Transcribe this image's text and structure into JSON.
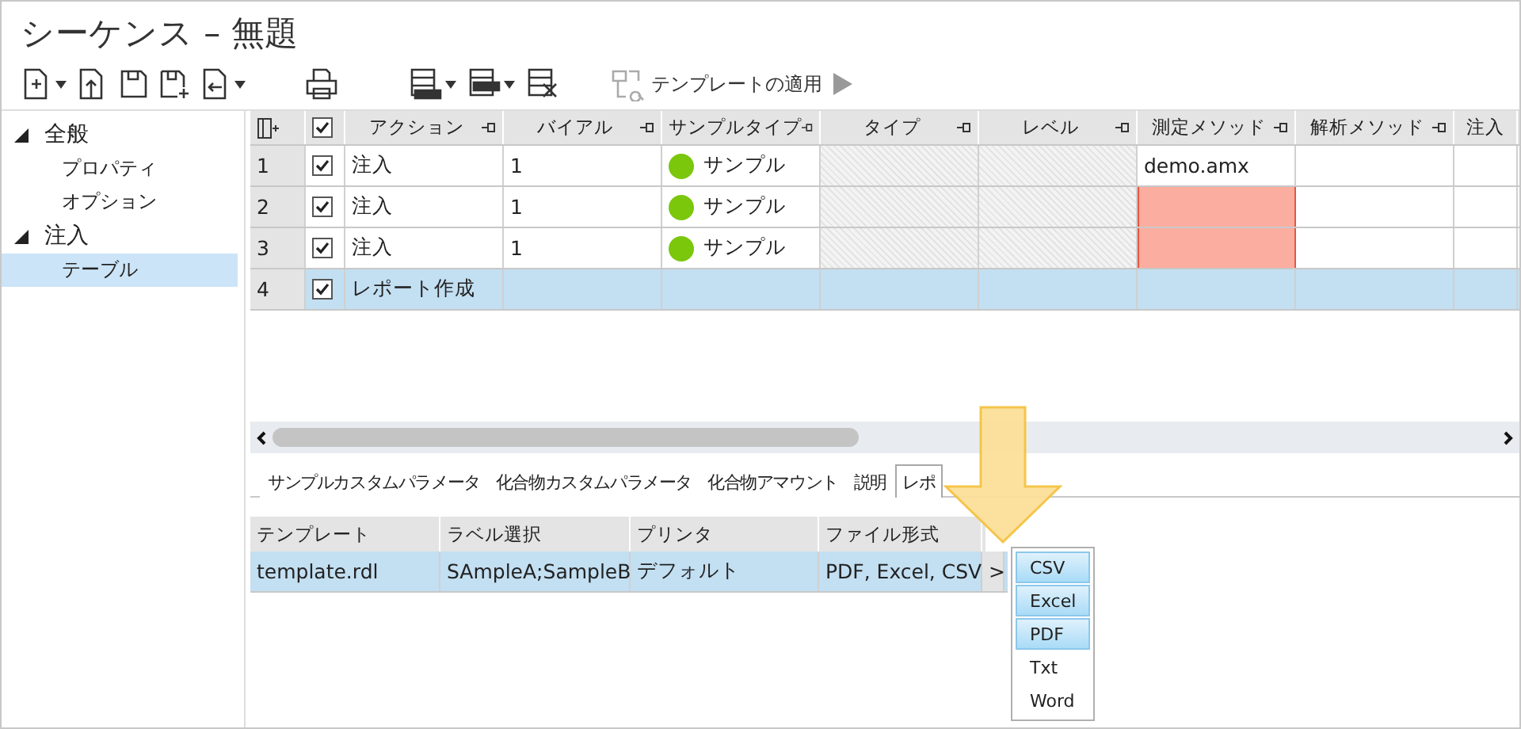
{
  "window": {
    "title": "シーケンス – 無題"
  },
  "toolbar": {
    "apply_template": "テンプレートの適用"
  },
  "sidebar": {
    "items": [
      {
        "label": "全般",
        "expanded": true,
        "children": [
          {
            "label": "プロパティ",
            "selected": false
          },
          {
            "label": "オプション",
            "selected": false
          }
        ]
      },
      {
        "label": "注入",
        "expanded": true,
        "children": [
          {
            "label": "テーブル",
            "selected": true
          }
        ]
      }
    ]
  },
  "table": {
    "select_all_checked": true,
    "columns": [
      {
        "label": "アクション",
        "hatched": false
      },
      {
        "label": "バイアル",
        "hatched": false
      },
      {
        "label": "サンプルタイプ",
        "hatched": false
      },
      {
        "label": "タイプ",
        "hatched": true
      },
      {
        "label": "レベル",
        "hatched": true
      },
      {
        "label": "測定メソッド",
        "hatched": false
      },
      {
        "label": "解析メソッド",
        "hatched": false
      },
      {
        "label": "注入",
        "hatched": false
      }
    ],
    "rows": [
      {
        "number": "1",
        "checked": true,
        "selected": false,
        "action": "注入",
        "vial": "1",
        "sample_type": {
          "label": "サンプル",
          "color": "#7ac70c"
        },
        "method": "demo.amx",
        "method_error": false
      },
      {
        "number": "2",
        "checked": true,
        "selected": false,
        "action": "注入",
        "vial": "1",
        "sample_type": {
          "label": "サンプル",
          "color": "#7ac70c"
        },
        "method_error": true
      },
      {
        "number": "3",
        "checked": true,
        "selected": false,
        "action": "注入",
        "vial": "1",
        "sample_type": {
          "label": "サンプル",
          "color": "#7ac70c"
        },
        "method_error": true
      },
      {
        "number": "4",
        "checked": true,
        "selected": true,
        "action": "レポート作成",
        "method_error": false
      }
    ]
  },
  "detail_tabs": [
    {
      "label": "サンプルカスタムパラメータ",
      "selected": false
    },
    {
      "label": "化合物カスタムパラメータ",
      "selected": false
    },
    {
      "label": "化合物アマウント",
      "selected": false
    },
    {
      "label": "説明",
      "selected": false
    },
    {
      "label": "レポ",
      "selected": true
    }
  ],
  "report_table": {
    "columns": [
      "テンプレート",
      "ラベル選択",
      "プリンタ",
      "ファイル形式"
    ],
    "rows": [
      {
        "selected": true,
        "cells": [
          "template.rdl",
          "SAmpleA;SampleB",
          "デフォルト",
          "PDF, Excel, CSV"
        ],
        "expander": ">"
      }
    ]
  },
  "format_dropdown": [
    {
      "label": "CSV",
      "selected": true
    },
    {
      "label": "Excel",
      "selected": true
    },
    {
      "label": "PDF",
      "selected": true
    },
    {
      "label": "Txt",
      "selected": false
    },
    {
      "label": "Word",
      "selected": false
    }
  ]
}
